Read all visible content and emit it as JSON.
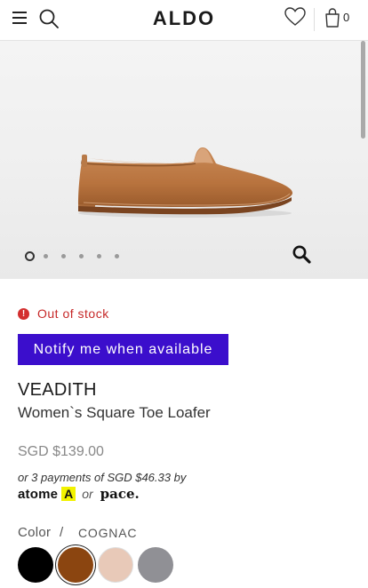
{
  "header": {
    "logo": "ALDO",
    "bag_count": "0",
    "icons": [
      "hamburger-menu-icon",
      "search-icon",
      "heart-icon",
      "shopping-bag-icon"
    ]
  },
  "hero": {
    "image_dots": 6,
    "active_dot": 1,
    "zoom_icon": "magnifier-icon"
  },
  "product": {
    "stock_status": "Out of stock",
    "notify_label": "Notify me when available",
    "name": "VEADITH",
    "subtitle": "Women`s Square Toe Loafer",
    "price": "SGD $139.00",
    "installment": "or 3 payments of SGD $46.33 by",
    "pay_atome": "atome",
    "pay_or": "or",
    "pay_pace": "pace."
  },
  "color": {
    "label": "Color",
    "separator": "/",
    "selected_name": "COGNAC",
    "swatches": [
      {
        "hex": "#000000",
        "selected": false
      },
      {
        "hex": "#8b4510",
        "selected": true
      },
      {
        "hex": "#e8c9b8",
        "selected": false
      },
      {
        "hex": "#909095",
        "selected": false
      }
    ]
  },
  "colors": {
    "accent_button": "#3b0ecc",
    "stock_red": "#c62828",
    "atome_yellow": "#f2f200"
  }
}
